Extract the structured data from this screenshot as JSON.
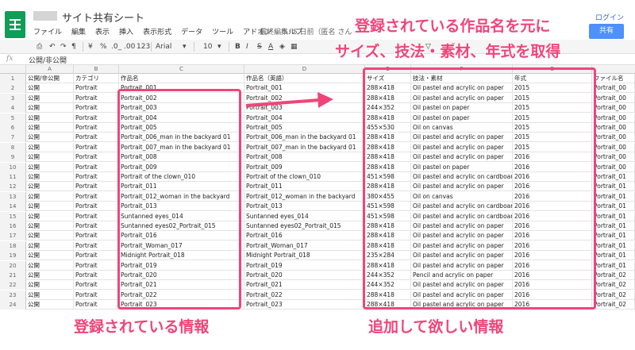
{
  "header": {
    "title": "サイト共有シート",
    "menu": [
      "ファイル",
      "編集",
      "表示",
      "挿入",
      "表示形式",
      "データ",
      "ツール",
      "アドオン",
      "ヘルプ"
    ],
    "last_edit": "最終編集: 5 日前（匿名 さん",
    "login": "ログイン",
    "share": "共有"
  },
  "toolbar": {
    "currency": "¥",
    "percent": "%",
    "decimal_less": ".0_",
    "decimal_more": ".00",
    "format_more": "123",
    "font": "Arial",
    "font_size": "10",
    "bold": "B",
    "italic": "I",
    "strike": "S",
    "text_color": "A",
    "sum": "Σ"
  },
  "formula_bar": {
    "fx": "fx",
    "value": "公開/非公開"
  },
  "columns": [
    "A",
    "B",
    "C",
    "D",
    "E",
    "F",
    "G"
  ],
  "rows": [
    {
      "n": "1",
      "a": "公開/非公開",
      "b": "カテゴリ",
      "c": "作品名",
      "d": "作品名（英語）",
      "e": "サイズ",
      "f": "技法・素材",
      "g": "年式",
      "h": "ファイル名"
    },
    {
      "n": "2",
      "a": "公開",
      "b": "Portrait",
      "c": "Portrait_001",
      "d": "Portrait_001",
      "e": "288×418",
      "f": "Oil pastel and acrylic on paper",
      "g": "2015",
      "h": "Portrait_00"
    },
    {
      "n": "3",
      "a": "公開",
      "b": "Portrait",
      "c": "Portrait_002",
      "d": "Portrait_002",
      "e": "288×418",
      "f": "Oil pastel and acrylic on paper",
      "g": "2015",
      "h": "Portrait_00"
    },
    {
      "n": "4",
      "a": "公開",
      "b": "Portrait",
      "c": "Portrait_003",
      "d": "Portrait_003",
      "e": "244×352",
      "f": "Oil pastel on paper",
      "g": "2015",
      "h": "Portrait_00"
    },
    {
      "n": "5",
      "a": "公開",
      "b": "Portrait",
      "c": "Portrait_004",
      "d": "Portrait_004",
      "e": "288×418",
      "f": "Oil pastel on paper",
      "g": "2015",
      "h": "Portrait_00"
    },
    {
      "n": "6",
      "a": "公開",
      "b": "Portrait",
      "c": "Portrait_005",
      "d": "Portrait_005",
      "e": "455×530",
      "f": "Oil on canvas",
      "g": "2015",
      "h": "Portrait_00"
    },
    {
      "n": "7",
      "a": "公開",
      "b": "Portrait",
      "c": "Portrait_006_man in the backyard 01",
      "d": "Portrait_006_man in the backyard 01",
      "e": "288×418",
      "f": "Oil pastel and acrylic on paper",
      "g": "2015",
      "h": "Portrait_00"
    },
    {
      "n": "8",
      "a": "公開",
      "b": "Portrait",
      "c": "Portrait_007_man in the backyard 01",
      "d": "Portrait_007_man in the backyard 01",
      "e": "288×418",
      "f": "Oil pastel and acrylic on paper",
      "g": "2015",
      "h": "Portrait_00"
    },
    {
      "n": "9",
      "a": "公開",
      "b": "Portrait",
      "c": "Portrait_008",
      "d": "Portrait_008",
      "e": "288×418",
      "f": "Oil pastel and acrylic on paper",
      "g": "2016",
      "h": "Portrait_00"
    },
    {
      "n": "10",
      "a": "公開",
      "b": "Portrait",
      "c": "Portrait_009",
      "d": "Portrait_009",
      "e": "288×418",
      "f": "Oil pastel on paper",
      "g": "2016",
      "h": "Portrait_00"
    },
    {
      "n": "11",
      "a": "公開",
      "b": "Portrait",
      "c": "Portrait of the clown_010",
      "d": "Portrait of the clown_010",
      "e": "451×598",
      "f": "Oil pastel and acrylic on cardboard",
      "g": "2016",
      "h": "Portrait_01"
    },
    {
      "n": "12",
      "a": "公開",
      "b": "Portrait",
      "c": "Portrait_011",
      "d": "Portrait_011",
      "e": "288×418",
      "f": "Oil pastel and acrylic on paper",
      "g": "2016",
      "h": "Portrait_01"
    },
    {
      "n": "13",
      "a": "公開",
      "b": "Portrait",
      "c": "Portrait_012_woman in the backyard",
      "d": "Portrait_012_woman in the backyard",
      "e": "380×455",
      "f": "Oil on canvas",
      "g": "2016",
      "h": "Portrait_01"
    },
    {
      "n": "14",
      "a": "公開",
      "b": "Portrait",
      "c": "Portrait_013",
      "d": "Portrait_013",
      "e": "451×598",
      "f": "Oil pastel and acrylic on cardboard",
      "g": "2016",
      "h": "Portrait_01"
    },
    {
      "n": "15",
      "a": "公開",
      "b": "Portrait",
      "c": "Suntanned eyes_014",
      "d": "Suntanned eyes_014",
      "e": "451×598",
      "f": "Oil pastel and acrylic on cardboard",
      "g": "2016",
      "h": "Portrait_01"
    },
    {
      "n": "16",
      "a": "公開",
      "b": "Portrait",
      "c": "Suntanned eyes02_Portrait_015",
      "d": "Suntanned eyes02_Portrait_015",
      "e": "288×418",
      "f": "Oil pastel and acrylic on paper",
      "g": "2016",
      "h": "Portrait_01"
    },
    {
      "n": "17",
      "a": "公開",
      "b": "Portrait",
      "c": "Portrait_016",
      "d": "Portrait_016",
      "e": "288×418",
      "f": "Oil pastel and acrylic on paper",
      "g": "2016",
      "h": "Portrait_01"
    },
    {
      "n": "18",
      "a": "公開",
      "b": "Portrait",
      "c": "Portrait_Woman_017",
      "d": "Portrait_Woman_017",
      "e": "288×418",
      "f": "Oil pastel and acrylic on paper",
      "g": "2016",
      "h": "Portrait_01"
    },
    {
      "n": "19",
      "a": "公開",
      "b": "Portrait",
      "c": "Midnight Portrait_018",
      "d": "Midnight Portrait_018",
      "e": "235×284",
      "f": "Oil pastel and acrylic on paper",
      "g": "2016",
      "h": "Portrait_01"
    },
    {
      "n": "20",
      "a": "公開",
      "b": "Portrait",
      "c": "Portrait_019",
      "d": "Portrait_019",
      "e": "288×418",
      "f": "Oil pastel and acrylic on paper",
      "g": "2016",
      "h": "Portrait_01"
    },
    {
      "n": "21",
      "a": "公開",
      "b": "Portrait",
      "c": "Portrait_020",
      "d": "Portrait_020",
      "e": "244×352",
      "f": "Pencil and acrylic on paper",
      "g": "2016",
      "h": "Portrait_02"
    },
    {
      "n": "22",
      "a": "公開",
      "b": "Portrait",
      "c": "Portrait_021",
      "d": "Portrait_021",
      "e": "244×352",
      "f": "Oil pastel and acrylic on paper",
      "g": "2016",
      "h": "Portrait_02"
    },
    {
      "n": "23",
      "a": "公開",
      "b": "Portrait",
      "c": "Portrait_022",
      "d": "Portrait_022",
      "e": "288×418",
      "f": "Oil pastel and acrylic on paper",
      "g": "2016",
      "h": "Portrait_02"
    },
    {
      "n": "24",
      "a": "公開",
      "b": "Portrait",
      "c": "Portrait_023",
      "d": "Portrait_023",
      "e": "288×418",
      "f": "Oil pastel and acrylic on paper",
      "g": "2016",
      "h": "Portrait_02"
    }
  ],
  "annotations": {
    "top_line1": "登録されている作品名を元に",
    "top_line2": "サイズ、技法・素材、年式を取得",
    "bottom_left": "登録されている情報",
    "bottom_right": "追加して欲しい情報",
    "color": "#f0457a"
  },
  "icons": {
    "print": "print-icon",
    "undo": "undo-icon",
    "redo": "redo-icon",
    "paint_format": "paint-format-icon",
    "fill": "fill-color-icon",
    "borders": "borders-icon",
    "link": "link-icon",
    "filter": "filter-icon",
    "arrow": "arrow-icon"
  }
}
